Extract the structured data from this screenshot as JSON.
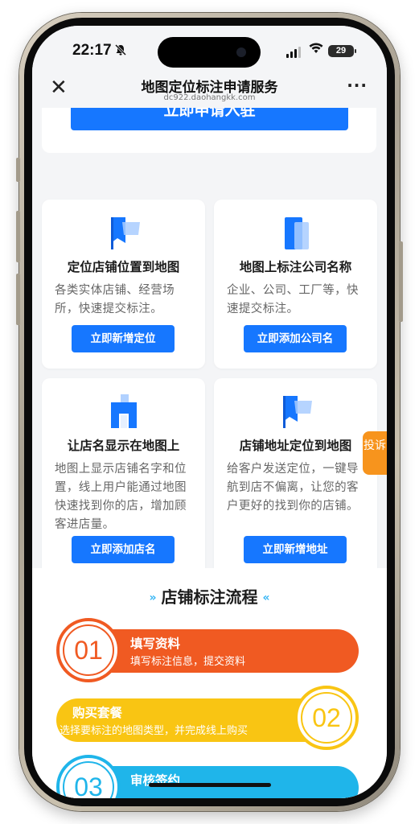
{
  "status_bar": {
    "time": "22:17",
    "battery": "29",
    "icons": [
      "bell-slash-icon",
      "signal-icon",
      "wifi-icon",
      "battery-icon"
    ]
  },
  "nav": {
    "title": "地图定位标注申请服务",
    "url": "dc922.daohangkk.com",
    "close_icon": "close-icon",
    "more_icon": "more-icon"
  },
  "top_button": {
    "label": "立即申请入驻"
  },
  "cards": [
    {
      "title": "定位店铺位置到地图",
      "desc": "各类实体店铺、经营场所，快速提交标注。",
      "button": "立即新增定位",
      "icon": "flag-icon"
    },
    {
      "title": "地图上标注公司名称",
      "desc": "企业、公司、工厂等，快速提交标注。",
      "button": "立即添加公司名",
      "icon": "building-icon"
    },
    {
      "title": "让店名显示在地图上",
      "desc": "地图上显示店铺名字和位置，线上用户能通过地图快速找到你的店，增加顾客进店量。",
      "button": "立即添加店名",
      "icon": "store-icon"
    },
    {
      "title": "店铺地址定位到地图",
      "desc": "给客户发送定位，一键导航到店不偏离，让您的客户更好的找到你的店铺。",
      "button": "立即新增地址",
      "icon": "flag-icon"
    }
  ],
  "complain_tab": {
    "label": "投诉"
  },
  "process": {
    "title": "店铺标注流程",
    "steps": [
      {
        "number": "01",
        "title": "填写资料",
        "desc": "填写标注信息，提交资料",
        "color": "#f05a22"
      },
      {
        "number": "02",
        "title": "购买套餐",
        "desc": "选择要标注的地图类型，并完成线上购买",
        "color": "#f9c513"
      },
      {
        "number": "03",
        "title": "审核签约",
        "desc": "",
        "color": "#1fb5ea"
      }
    ]
  },
  "colors": {
    "accent": "#1677ff",
    "background": "#f4f5f7",
    "complain": "#f7941d"
  }
}
